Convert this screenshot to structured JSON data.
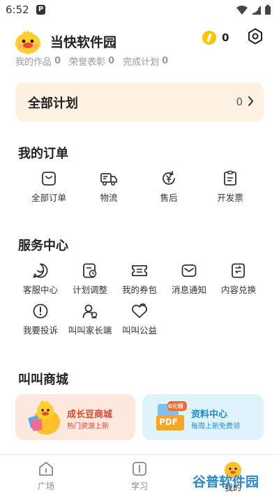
{
  "status": {
    "time": "6:52",
    "p_badge": "P"
  },
  "profile": {
    "name": "当快软件园",
    "coins": "0"
  },
  "stats": [
    {
      "label": "我的作品",
      "count": "0"
    },
    {
      "label": "荣誉表彰",
      "count": "0"
    },
    {
      "label": "完成计划",
      "count": "0"
    }
  ],
  "plan": {
    "title": "全部计划",
    "count": "0"
  },
  "orders": {
    "title": "我的订单",
    "items": [
      {
        "label": "全部订单",
        "icon": "order-icon"
      },
      {
        "label": "物流",
        "icon": "truck-icon"
      },
      {
        "label": "售后",
        "icon": "yen-refresh-icon"
      },
      {
        "label": "开发票",
        "icon": "invoice-icon"
      }
    ]
  },
  "service": {
    "title": "服务中心",
    "items": [
      {
        "label": "客服中心",
        "icon": "chat-icon"
      },
      {
        "label": "计划调整",
        "icon": "plan-adjust-icon"
      },
      {
        "label": "我的券包",
        "icon": "coupon-icon"
      },
      {
        "label": "消息通知",
        "icon": "mail-icon"
      },
      {
        "label": "内容兑换",
        "icon": "exchange-icon"
      },
      {
        "label": "我要投诉",
        "icon": "warning-icon"
      },
      {
        "label": "叫叫家长端",
        "icon": "parent-icon"
      },
      {
        "label": "叫叫公益",
        "icon": "charity-icon"
      }
    ]
  },
  "mall": {
    "title": "叫叫商城",
    "cards": [
      {
        "title": "成长豆商城",
        "subtitle": "热门资源上新"
      },
      {
        "title": "资料中心",
        "subtitle": "每周上新免费领",
        "badge": "0元领",
        "file": "PDF"
      }
    ]
  },
  "nav": [
    {
      "label": "广场"
    },
    {
      "label": "学习"
    },
    {
      "label": "我的"
    }
  ],
  "watermark": "谷普软件园",
  "colors": {
    "plan_bg": "#fdf2e2",
    "coin": "#ffc400",
    "mall_left": "#fde8de",
    "mall_right": "#e0f3fb"
  }
}
